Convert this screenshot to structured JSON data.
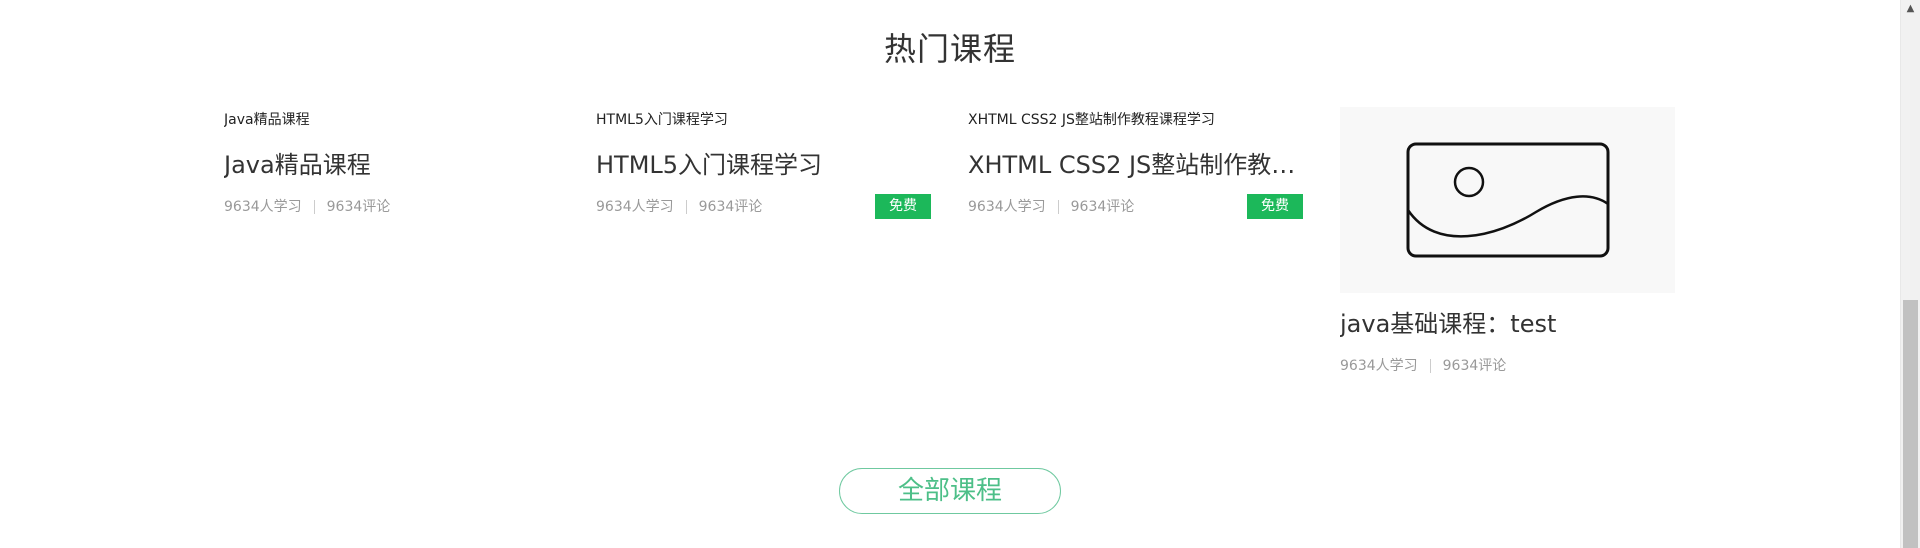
{
  "section": {
    "title": "热门课程"
  },
  "courses": [
    {
      "thumb_label": "Java精品课程",
      "title": "Java精品课程",
      "students": "9634人学习",
      "comments": "9634评论",
      "badge": ""
    },
    {
      "thumb_label": "HTML5入门课程学习",
      "title": "HTML5入门课程学习",
      "students": "9634人学习",
      "comments": "9634评论",
      "badge": "免费"
    },
    {
      "thumb_label": "XHTML CSS2 JS整站制作教程课程学习",
      "title": "XHTML CSS2 JS整站制作教程...",
      "students": "9634人学习",
      "comments": "9634评论",
      "badge": "免费"
    },
    {
      "thumb_icon": "image-placeholder-icon",
      "title": "java基础课程：test",
      "students": "9634人学习",
      "comments": "9634评论",
      "badge": ""
    }
  ],
  "all_courses_button": {
    "label": "全部课程"
  },
  "colors": {
    "accent_green": "#1cb85a",
    "button_green": "#4dbf88",
    "meta_gray": "#999999"
  }
}
